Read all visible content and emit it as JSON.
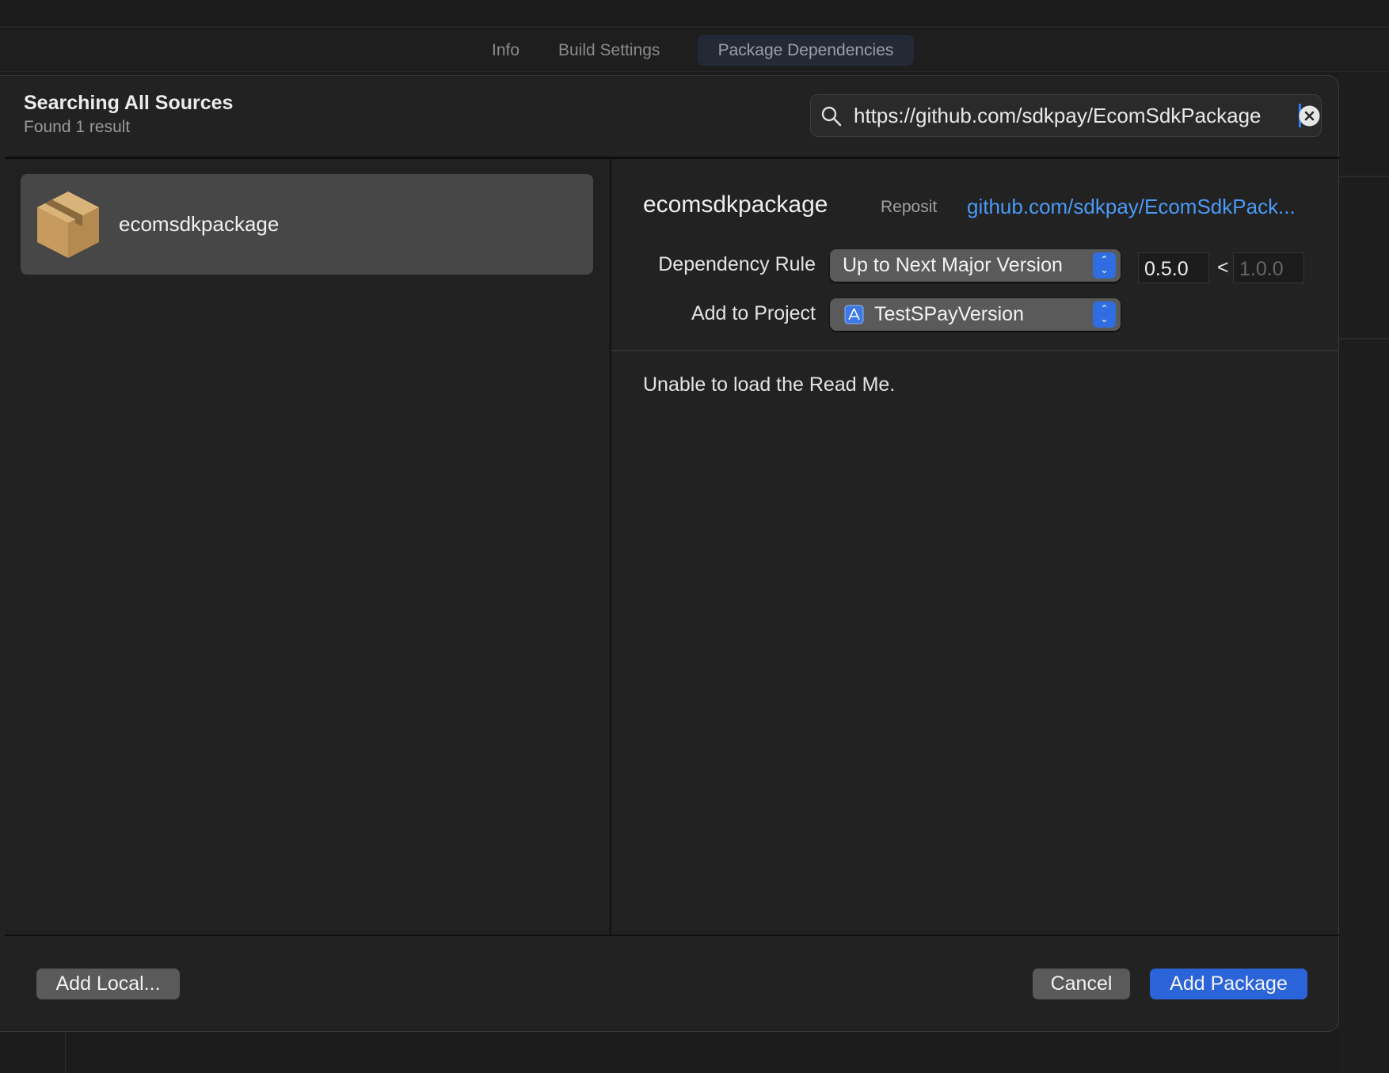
{
  "tabs": [
    {
      "label": "Info"
    },
    {
      "label": "Build Settings"
    },
    {
      "label": "Package Dependencies",
      "active": true
    }
  ],
  "header": {
    "title": "Searching All Sources",
    "subtitle": "Found 1 result"
  },
  "search": {
    "value": "https://github.com/sdkpay/EcomSdkPackage",
    "icon": "magnifying-glass-icon",
    "clear_icon": "clear-circle-icon"
  },
  "results": [
    {
      "name": "ecomsdkpackage",
      "icon": "package-box-icon",
      "selected": true
    }
  ],
  "detail": {
    "name": "ecomsdkpackage",
    "repository_label": "Reposit",
    "repository_link": "github.com/sdkpay/EcomSdkPack...",
    "dependency_rule_label": "Dependency Rule",
    "dependency_rule_value": "Up to Next Major Version",
    "version_min": "0.5.0",
    "version_separator": "<",
    "version_max": "1.0.0",
    "add_to_project_label": "Add to Project",
    "add_to_project_value": "TestSPayVersion",
    "readme": "Unable to load the Read Me."
  },
  "footer": {
    "add_local": "Add Local...",
    "cancel": "Cancel",
    "add_package": "Add Package"
  },
  "colors": {
    "accent": "#2b64d9",
    "link": "#4a9af7",
    "package_icon": "#c79b5e"
  }
}
